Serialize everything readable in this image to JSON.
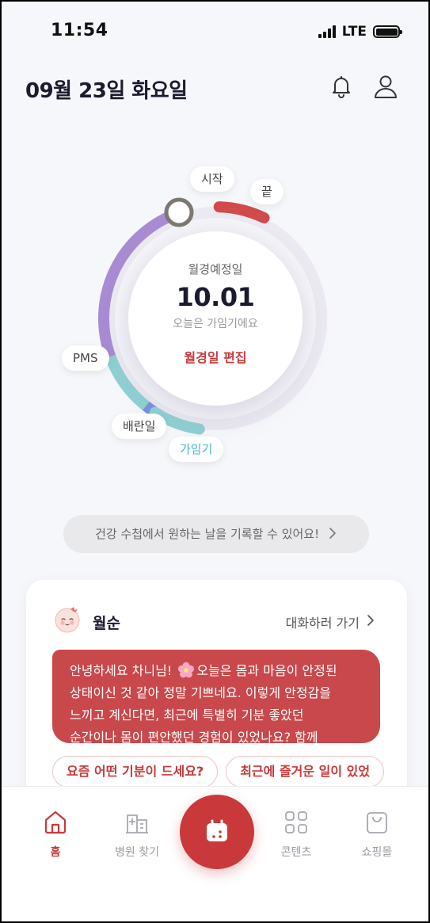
{
  "status_bar": {
    "time": "11:54",
    "network": "LTE"
  },
  "header": {
    "date": "09월 23일 화요일",
    "icons": [
      "bell-icon",
      "user-icon"
    ]
  },
  "cycle": {
    "labels": {
      "start": "시작",
      "end": "끝",
      "pms": "PMS",
      "ovulation": "배란일",
      "fertile": "가임기"
    },
    "center_label": "월경예정일",
    "next_period_date": "10.01",
    "status": "오늘은 가임기에요",
    "edit_button": "월경일 편집",
    "colors": {
      "period": "#d14a4c",
      "pms": "#a98bd3",
      "fertile": "#8fd0d3",
      "ovulation": "#7b8fe0",
      "track": "#eceaf2"
    }
  },
  "banner": {
    "text": "건강 수첩에서 원하는 날을 기록할 수 있어요!"
  },
  "chat_card": {
    "name": "월순",
    "link": "대화하러 가기",
    "message_lines": [
      [
        "안녕하세요 차니님! ",
        "오늘은 몸과 마음이 안정된"
      ],
      "상태이신 것 같아 정말 기쁘네요. 이렇게 안정감을",
      "느끼고 계신다면, 최근에 특별히 기분 좋았던",
      "순간이나 몸이 편안했던 경험이 있었나요? 함께"
    ],
    "quick_replies": [
      "요즘 어떤 기분이 드세요?",
      "최근에 즐거운 일이 있었"
    ]
  },
  "tabbar": {
    "home": "홈",
    "hospital": "병원 찾기",
    "contents": "콘텐츠",
    "shop": "쇼핑몰",
    "active_color": "#c8393b"
  }
}
